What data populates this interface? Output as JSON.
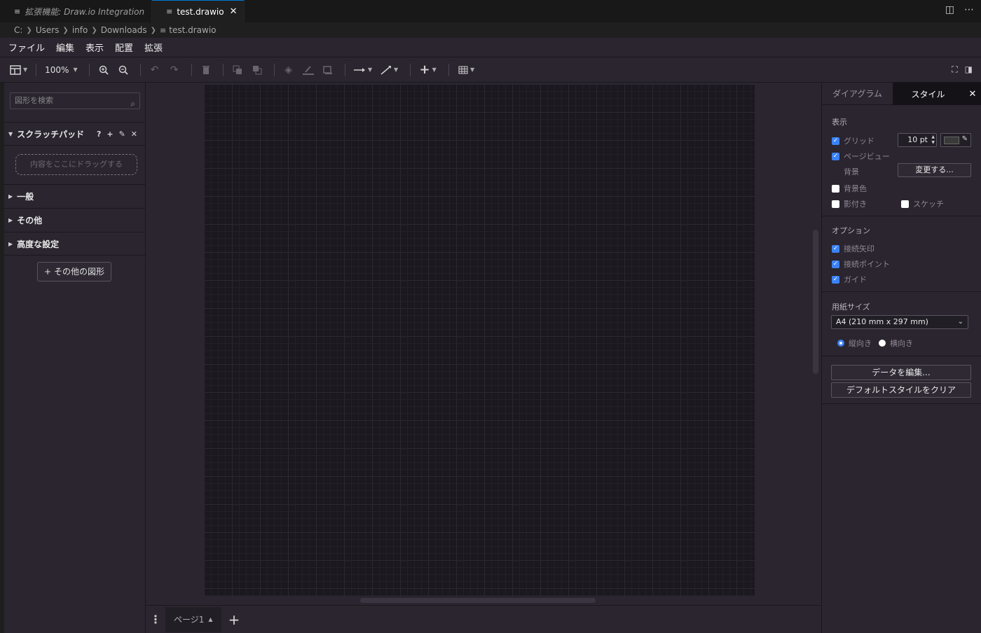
{
  "tabs": [
    {
      "label": "拡張機能: Draw.io Integration",
      "active": false
    },
    {
      "label": "test.drawio",
      "active": true
    }
  ],
  "breadcrumb": [
    "C:",
    "Users",
    "info",
    "Downloads",
    "test.drawio"
  ],
  "menu": [
    "ファイル",
    "編集",
    "表示",
    "配置",
    "拡張"
  ],
  "toolbar": {
    "zoom": "100%",
    "icons": [
      "format-panel-icon",
      "zoom-in-icon",
      "zoom-out-icon",
      "undo-icon",
      "redo-icon",
      "delete-icon",
      "to-front-icon",
      "to-back-icon",
      "fill-color-icon",
      "line-color-icon",
      "shadow-icon",
      "connection-icon",
      "waypoints-icon",
      "insert-icon",
      "table-icon",
      "fullscreen-icon",
      "toggle-panel-icon"
    ]
  },
  "left_panel": {
    "search_placeholder": "図形を検索",
    "scratchpad_title": "スクラッチパッド",
    "scratchpad_actions": [
      "?",
      "+",
      "✎",
      "✕"
    ],
    "drop_hint": "内容をここにドラッグする",
    "sections": [
      "一般",
      "その他",
      "高度な設定"
    ],
    "more_shapes": "その他の図形"
  },
  "page_tabs": {
    "current": "ページ1"
  },
  "right_panel": {
    "tabs": [
      "ダイアグラム",
      "スタイル"
    ],
    "active_tab": "スタイル",
    "view_label": "表示",
    "grid_label": "グリッド",
    "grid_checked": true,
    "grid_size": "10 pt",
    "page_view_label": "ページビュー",
    "page_view_checked": true,
    "background_label": "背景",
    "change_button": "変更する...",
    "bg_color_label": "背景色",
    "bg_color_checked": false,
    "shadow_label": "影付き",
    "shadow_checked": false,
    "sketch_label": "スケッチ",
    "sketch_checked": false,
    "options_label": "オプション",
    "connection_arrows_label": "接続矢印",
    "connection_points_label": "接続ポイント",
    "guides_label": "ガイド",
    "paper_size_label": "用紙サイズ",
    "paper_size_value": "A4 (210 mm x 297 mm)",
    "portrait_label": "縦向き",
    "landscape_label": "横向き",
    "orientation": "portrait",
    "edit_data_button": "データを編集...",
    "clear_style_button": "デフォルトスタイルをクリア"
  },
  "colors": {
    "accent": "#3b82f6",
    "panel_bg": "#2a252f",
    "canvas_bg": "#1b181f"
  }
}
